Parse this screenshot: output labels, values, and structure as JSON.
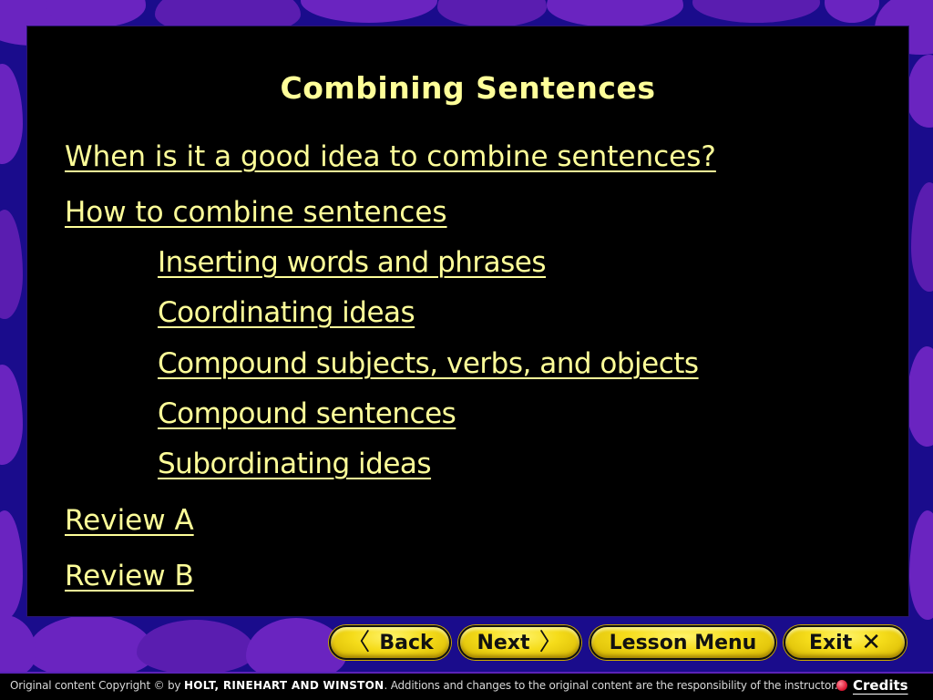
{
  "slide": {
    "title": "Combining Sentences",
    "links": [
      {
        "label": "When is it a good idea to combine sentences?",
        "level": 0
      },
      {
        "label": "How to combine sentences",
        "level": 0
      },
      {
        "label": "Inserting words and phrases",
        "level": 1
      },
      {
        "label": "Coordinating ideas",
        "level": 1
      },
      {
        "label": "Compound subjects, verbs, and objects",
        "level": 1
      },
      {
        "label": "Compound sentences",
        "level": 1
      },
      {
        "label": "Subordinating ideas",
        "level": 1
      },
      {
        "label": "Review A",
        "level": 0
      },
      {
        "label": "Review B",
        "level": 0
      }
    ]
  },
  "nav": {
    "back": {
      "label": "Back",
      "icon": "chevron-left-icon",
      "glyph": "〈"
    },
    "next": {
      "label": "Next",
      "icon": "chevron-right-icon",
      "glyph": "〉"
    },
    "lesson_menu": {
      "label": "Lesson Menu"
    },
    "exit": {
      "label": "Exit",
      "icon": "close-icon",
      "glyph": "✕"
    }
  },
  "footer": {
    "copyright_prefix": "Original content Copyright © by",
    "publisher": "HOLT, RINEHART AND WINSTON",
    "copyright_suffix": ". Additions and changes to the original content are the responsibility of the instructor.",
    "credits_label": "Credits"
  },
  "colors": {
    "link_text": "#ffff99",
    "panel": "#000000",
    "background_purple": "#5b22b8",
    "background_blue": "#1a0c8c",
    "button_yellow": "#f5dc1a",
    "credits_dot": "#e0203a"
  }
}
